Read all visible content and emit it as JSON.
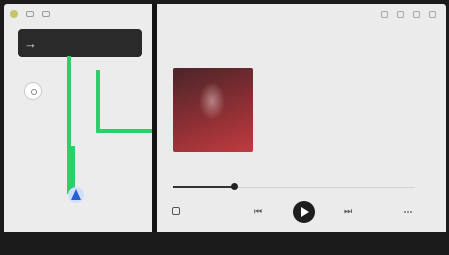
{
  "map": {
    "nav_turn_symbol": "→",
    "nav_distance": "",
    "nav_street": "",
    "nav_side": "",
    "labels": [
      "",
      "",
      ""
    ],
    "footer": [
      "",
      ""
    ]
  },
  "music": {
    "header_title": "",
    "source": "",
    "source_sub": "",
    "song_title": "",
    "artist": "",
    "album_art_label": "",
    "progress": 0.25,
    "controls": {
      "prev_symbol": "⏮",
      "next_symbol": "⏭"
    }
  },
  "bottom_bar": {
    "items": [
      "",
      "",
      "",
      "",
      "",
      "",
      "",
      ""
    ]
  },
  "colors": {
    "route": "#2ecf6a",
    "position": "#2b5fd6",
    "panel": "#ebebeb",
    "bar": "#1b1b1b",
    "album_art": "#8c2f34"
  },
  "icons": {
    "map_status": [
      "status-dot-icon",
      "map-icon",
      "settings-icon"
    ],
    "music_header": [
      "search-icon",
      "list-icon",
      "queue-icon",
      "more-icon"
    ],
    "music_controls": [
      "library-icon",
      "previous-icon",
      "play-icon",
      "next-icon",
      "more-icon"
    ]
  }
}
